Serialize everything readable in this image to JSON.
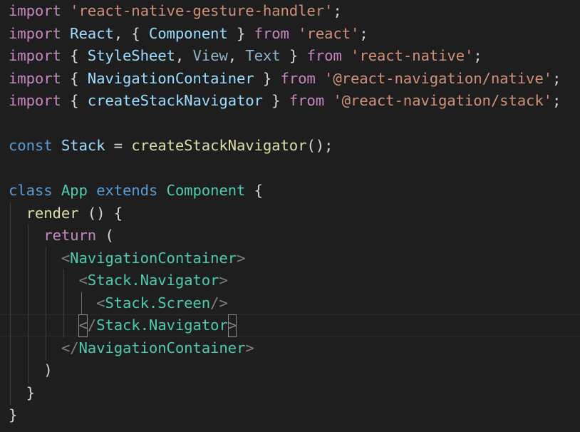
{
  "code": {
    "line1": {
      "t1": "import",
      "t2": " ",
      "t3": "'react-native-gesture-handler'",
      "t4": ";"
    },
    "line2": {
      "t1": "import",
      "t2": " ",
      "t3": "React",
      "t4": ", { ",
      "t5": "Component",
      "t6": " } ",
      "t7": "from",
      "t8": " ",
      "t9": "'react'",
      "t10": ";"
    },
    "line3": {
      "t1": "import",
      "t2": " { ",
      "t3": "StyleSheet",
      "t4": ", ",
      "t5": "View",
      "t6": ", ",
      "t7": "Text",
      "t8": " } ",
      "t9": "from",
      "t10": " ",
      "t11": "'react-native'",
      "t12": ";"
    },
    "line4": {
      "t1": "import",
      "t2": " { ",
      "t3": "NavigationContainer",
      "t4": " } ",
      "t5": "from",
      "t6": " ",
      "t7": "'@react-navigation/native'",
      "t8": ";"
    },
    "line5": {
      "t1": "import",
      "t2": " { ",
      "t3": "createStackNavigator",
      "t4": " } ",
      "t5": "from",
      "t6": " ",
      "t7": "'@react-navigation/stack'",
      "t8": ";"
    },
    "line7": {
      "t1": "const",
      "t2": " ",
      "t3": "Stack",
      "t4": " = ",
      "t5": "createStackNavigator",
      "t6": "();"
    },
    "line9": {
      "t1": "class",
      "t2": " ",
      "t3": "App",
      "t4": " ",
      "t5": "extends",
      "t6": " ",
      "t7": "Component",
      "t8": " {"
    },
    "line10": {
      "t1": "  ",
      "t2": "render",
      "t3": " () {"
    },
    "line11": {
      "t1": "    ",
      "t2": "return",
      "t3": " ("
    },
    "line12": {
      "t1": "      ",
      "t2": "<",
      "t3": "NavigationContainer",
      "t4": ">"
    },
    "line13": {
      "t1": "        ",
      "t2": "<",
      "t3": "Stack.Navigator",
      "t4": ">"
    },
    "line14": {
      "t1": "          ",
      "t2": "<",
      "t3": "Stack.Screen",
      "t4": "/>"
    },
    "line15": {
      "t1": "        ",
      "t2": "<",
      "t3": "/",
      "t4": "Stack.Navigator",
      "t5": ">"
    },
    "line16": {
      "t1": "      ",
      "t2": "</",
      "t3": "NavigationContainer",
      "t4": ">"
    },
    "line17": {
      "t1": "    ",
      "t2": ")"
    },
    "line18": {
      "t1": "  ",
      "t2": "}"
    },
    "line19": {
      "t1": "}"
    }
  }
}
